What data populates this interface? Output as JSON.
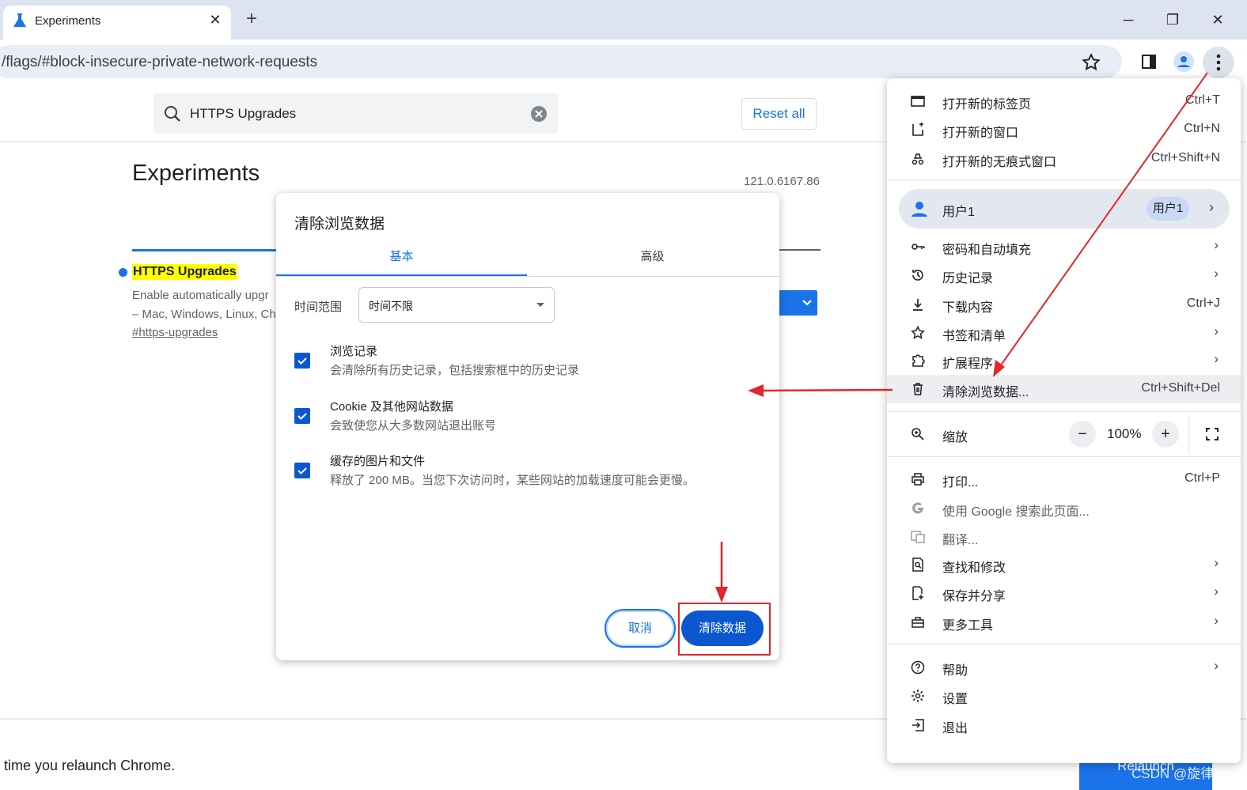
{
  "browser": {
    "tab_title": "Experiments",
    "tab_close": "✕",
    "new_tab": "+",
    "url": "/flags/#block-insecure-private-network-requests",
    "window_minimize": "─",
    "window_restore": "❐",
    "window_close": "✕"
  },
  "page": {
    "search_value": "HTTPS Upgrades",
    "reset_all": "Reset all",
    "title": "Experiments",
    "version": "121.0.6167.86",
    "flag_name": "HTTPS Upgrades",
    "flag_desc_line1": "Enable automatically upgr",
    "flag_desc_line2": "– Mac, Windows, Linux, Ch",
    "flag_link": "#https-upgrades",
    "relaunch_text": "time you relaunch Chrome.",
    "relaunch_button": "Relaunch"
  },
  "dialog": {
    "title": "清除浏览数据",
    "tabs": [
      "基本",
      "高级"
    ],
    "time_range_label": "时间范围",
    "time_range_value": "时间不限",
    "items": [
      {
        "title": "浏览记录",
        "desc": "会清除所有历史记录，包括搜索框中的历史记录",
        "checked": true
      },
      {
        "title": "Cookie 及其他网站数据",
        "desc": "会致使您从大多数网站退出账号",
        "checked": true
      },
      {
        "title": "缓存的图片和文件",
        "desc": "释放了 200 MB。当您下次访问时，某些网站的加载速度可能会更慢。",
        "checked": true
      }
    ],
    "cancel": "取消",
    "confirm": "清除数据"
  },
  "menu": {
    "new_tab": {
      "label": "打开新的标签页",
      "shortcut": "Ctrl+T"
    },
    "new_window": {
      "label": "打开新的窗口",
      "shortcut": "Ctrl+N"
    },
    "incognito": {
      "label": "打开新的无痕式窗口",
      "shortcut": "Ctrl+Shift+N"
    },
    "profile": {
      "label": "用户1",
      "badge": "用户1"
    },
    "passwords": {
      "label": "密码和自动填充"
    },
    "history": {
      "label": "历史记录"
    },
    "downloads": {
      "label": "下载内容",
      "shortcut": "Ctrl+J"
    },
    "bookmarks": {
      "label": "书签和清单"
    },
    "extensions": {
      "label": "扩展程序"
    },
    "clear_data": {
      "label": "清除浏览数据...",
      "shortcut": "Ctrl+Shift+Del"
    },
    "zoom": {
      "label": "缩放",
      "minus": "−",
      "value": "100%",
      "plus": "+"
    },
    "print": {
      "label": "打印...",
      "shortcut": "Ctrl+P"
    },
    "google_search": {
      "label": "使用 Google 搜索此页面..."
    },
    "translate": {
      "label": "翻译..."
    },
    "find": {
      "label": "查找和修改"
    },
    "save_share": {
      "label": "保存并分享"
    },
    "more_tools": {
      "label": "更多工具"
    },
    "help": {
      "label": "帮助"
    },
    "settings": {
      "label": "设置"
    },
    "exit": {
      "label": "退出"
    },
    "chevron": "›"
  },
  "watermark": "CSDN @旋律.",
  "colors": {
    "accent": "#1a73e8",
    "dialog_button": "#0b57d0",
    "annotation_red": "#e3262a",
    "highlight": "#ffff00"
  }
}
